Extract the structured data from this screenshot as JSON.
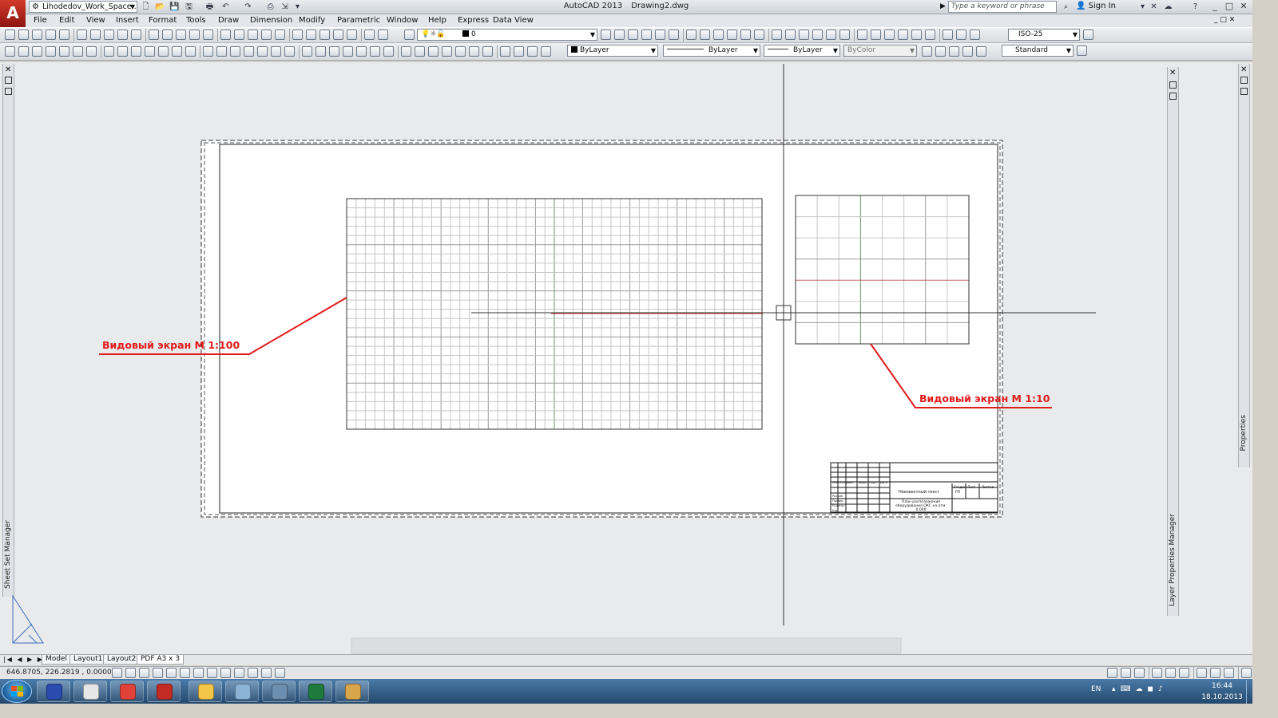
{
  "app": {
    "logo_letter": "A",
    "workspace": "Lihodedov_Work_Space...",
    "title_app": "AutoCAD 2013",
    "title_file": "Drawing2.dwg",
    "search_placeholder": "Type a keyword or phrase",
    "signin": "Sign In"
  },
  "menu": [
    "File",
    "Edit",
    "View",
    "Insert",
    "Format",
    "Tools",
    "Draw",
    "Dimension",
    "Modify",
    "Parametric",
    "Window",
    "Help",
    "Express",
    "Data View"
  ],
  "toolbar": {
    "layer_value": "0",
    "dimstyle_value": "ISO-25",
    "color_value": "ByLayer",
    "linetype_value": "ByLayer",
    "lineweight_value": "ByLayer",
    "plotstyle_value": "ByColor",
    "textstyle_value": "Standard"
  },
  "drawing": {
    "annotation_left": "Видовый экран М 1:100",
    "annotation_right": "Видовый экран М 1:10",
    "title_block": {
      "row_labels": [
        "Изм.",
        "Кол.уч",
        "Лист",
        "№док",
        "Подп.",
        "Дата"
      ],
      "role_labels": [
        "Разраб.",
        "Провер.",
        "Н.контр.",
        "Утв."
      ],
      "stage_labels": [
        "Стадия",
        "Лист",
        "Листов"
      ],
      "stage_value": "РП",
      "name_text": "Неизвестный текст",
      "desc_text": "План расположения оборудования ОКС на отм. 0.000"
    }
  },
  "panels": {
    "left_label": "Sheet Set Manager",
    "right_label": "Layer Properties Manager",
    "far_right_label": "Properties"
  },
  "layout_tabs": [
    "Model",
    "Layout1",
    "Layout2",
    "PDF A3 x 3"
  ],
  "active_tab": "PDF A3 x 3",
  "status": {
    "coords": "646.8705, 226.2819 , 0.0000"
  },
  "taskbar": {
    "lang": "EN",
    "time": "16:44",
    "date": "18.10.2013",
    "apps": [
      "floppy-disk",
      "calculator",
      "chrome",
      "autocad",
      "folder",
      "notebook",
      "network",
      "excel",
      "paint"
    ]
  }
}
